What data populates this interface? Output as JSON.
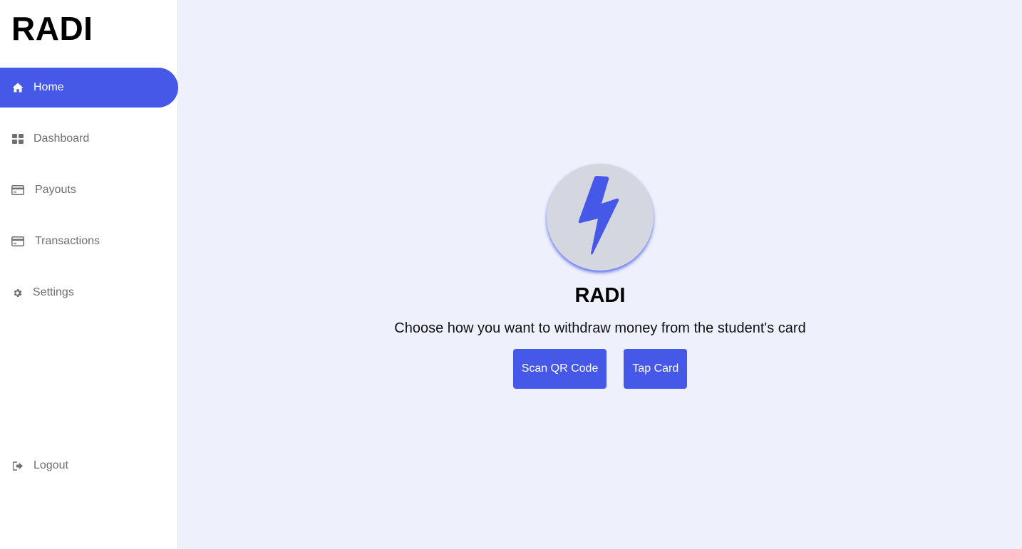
{
  "brand": "RADI",
  "sidebar": {
    "items": [
      {
        "label": "Home",
        "icon": "home-icon",
        "active": true
      },
      {
        "label": "Dashboard",
        "icon": "dashboard-grid-icon"
      },
      {
        "label": "Payouts",
        "icon": "credit-card-icon"
      },
      {
        "label": "Transactions",
        "icon": "credit-card-icon"
      },
      {
        "label": "Settings",
        "icon": "gear-icon"
      }
    ],
    "logout": {
      "label": "Logout",
      "icon": "logout-icon"
    }
  },
  "main": {
    "logo_icon": "lightning-bolt-icon",
    "title": "RADI",
    "subtitle": "Choose how you want to withdraw money from the student's card",
    "buttons": {
      "scan_qr": "Scan QR Code",
      "tap_card": "Tap Card"
    }
  },
  "colors": {
    "accent": "#4658e8",
    "main_background": "#eef0fb",
    "sidebar_background": "#ffffff",
    "inactive_text": "#6e6e73",
    "logo_circle": "#d4d7e0"
  }
}
